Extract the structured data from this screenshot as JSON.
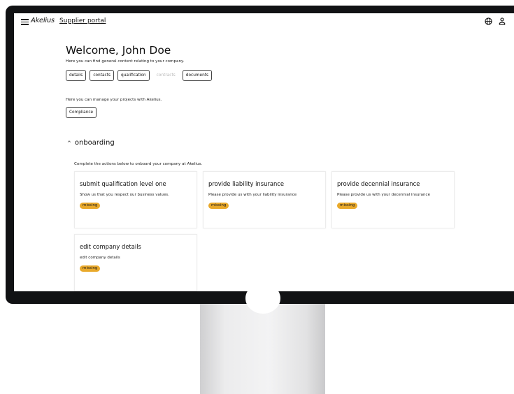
{
  "header": {
    "menu_icon": "hamburger-menu-icon",
    "logo_text": "Akelius",
    "portal_link": "Supplier portal",
    "globe_icon": "globe-icon",
    "user_icon": "user-icon"
  },
  "welcome": {
    "title": "Welcome, John Doe",
    "intro": "Here you can find general content relating to your company.",
    "buttons": [
      {
        "label": "details",
        "enabled": true
      },
      {
        "label": "contacts",
        "enabled": true
      },
      {
        "label": "qualification",
        "enabled": true
      },
      {
        "label": "contracts",
        "enabled": false
      },
      {
        "label": "documents",
        "enabled": true
      }
    ]
  },
  "projects": {
    "intro": "Here you can manage your projects with Akelius.",
    "compliance_label": "Compliance"
  },
  "onboarding": {
    "chevron_icon": "chevron-up-icon",
    "title": "onboarding",
    "description": "Complete the actions below to onboard your company at Akelius.",
    "cards": [
      {
        "title": "submit qualification level one",
        "description": "Show us that you respect our business values.",
        "status": "missing"
      },
      {
        "title": "provide liability insurance",
        "description": "Please provide us with your liability insurance",
        "status": "missing"
      },
      {
        "title": "provide decennial insurance",
        "description": "Please provide us with your decennial insurance",
        "status": "missing"
      },
      {
        "title": "edit company details",
        "description": "edit company details",
        "status": "missing"
      }
    ]
  },
  "colors": {
    "badge_missing": "#e9a92b",
    "bezel": "#111214"
  }
}
